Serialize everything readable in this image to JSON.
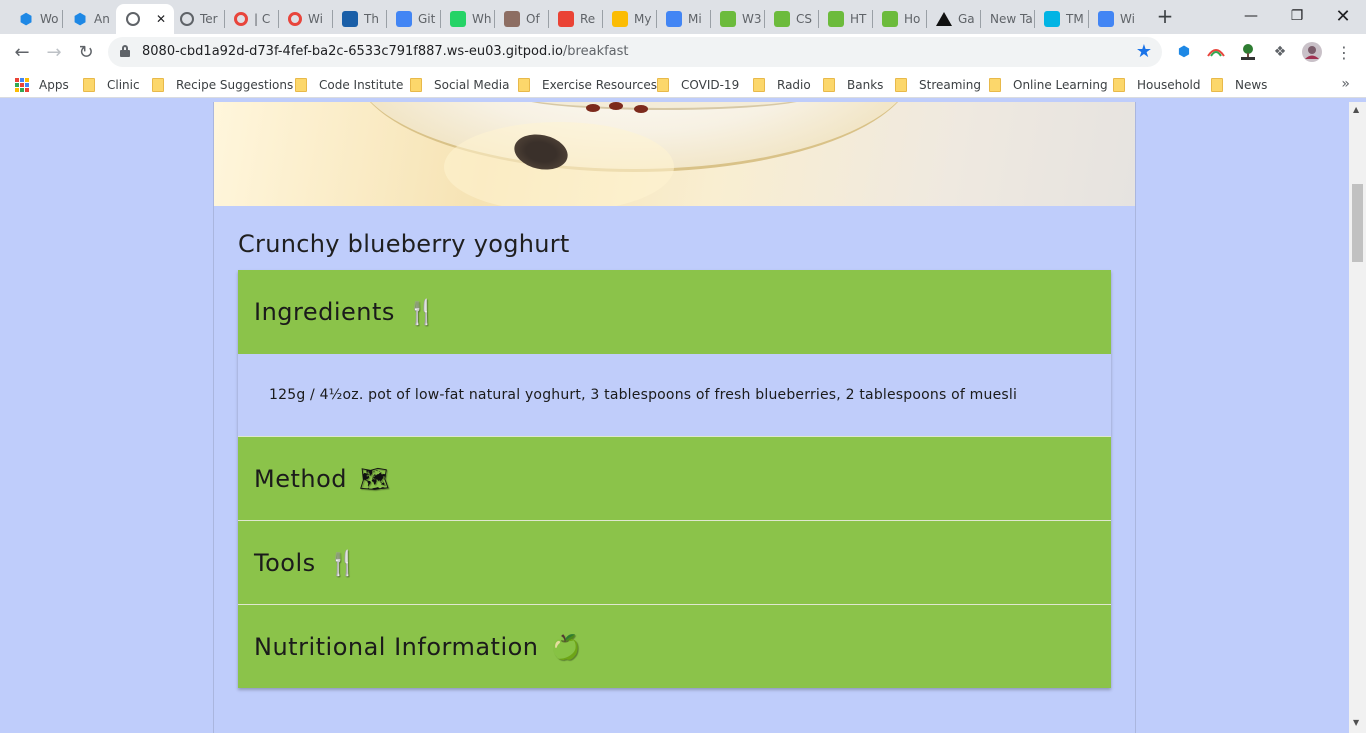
{
  "browser": {
    "tabs": [
      {
        "title": "Wo",
        "favicon": "gitpod-icon",
        "color": "#1e88e5"
      },
      {
        "title": "An",
        "favicon": "gitpod-icon",
        "color": "#1e88e5"
      },
      {
        "title": "",
        "favicon": "globe-icon",
        "color": "#5f6368",
        "active": true
      },
      {
        "title": "Ter",
        "favicon": "globe-icon",
        "color": "#5f6368"
      },
      {
        "title": "| C",
        "favicon": "opera-icon",
        "color": "#e8453c"
      },
      {
        "title": "Wi",
        "favicon": "opera-icon",
        "color": "#e8453c"
      },
      {
        "title": "Th",
        "favicon": "w3-icon",
        "color": "#1a5fa8"
      },
      {
        "title": "Git",
        "favicon": "docs-icon",
        "color": "#4285f4"
      },
      {
        "title": "Wh",
        "favicon": "whatsapp-icon",
        "color": "#25d366"
      },
      {
        "title": "Of",
        "favicon": "crest-icon",
        "color": "#8d6e63"
      },
      {
        "title": "Re",
        "favicon": "gmail-icon",
        "color": "#ea4335"
      },
      {
        "title": "My",
        "favicon": "drive-icon",
        "color": "#fbbc04"
      },
      {
        "title": "Mi",
        "favicon": "docs-icon",
        "color": "#4285f4"
      },
      {
        "title": "W3",
        "favicon": "w3c-icon",
        "color": "#6cbb3c"
      },
      {
        "title": "CS",
        "favicon": "w3c-icon",
        "color": "#6cbb3c"
      },
      {
        "title": "HT",
        "favicon": "w3c-icon",
        "color": "#6cbb3c"
      },
      {
        "title": "Ho",
        "favicon": "w3c-icon",
        "color": "#6cbb3c"
      },
      {
        "title": "Ga",
        "favicon": "triangle-icon",
        "color": "#111111"
      },
      {
        "title": "New Ta",
        "favicon": "",
        "color": ""
      },
      {
        "title": "TM",
        "favicon": "tmdb-icon",
        "color": "#01b4e4"
      },
      {
        "title": "Wi",
        "favicon": "google-icon",
        "color": "#4285f4"
      }
    ],
    "url_host": "8080-cbd1a92d-d73f-4fef-ba2c-6533c791f887.ws-eu03.gitpod.io",
    "url_path": "/breakfast",
    "bookmarks": [
      "Apps",
      "Clinic",
      "Recipe Suggestions",
      "Code Institute",
      "Social Media",
      "Exercise Resources",
      "COVID-19",
      "Radio",
      "Banks",
      "Streaming",
      "Online Learning",
      "Household",
      "News"
    ],
    "bookmarks_more": "»"
  },
  "page": {
    "recipe_title": "Crunchy blueberry yoghurt",
    "sections": [
      {
        "label": "Ingredients",
        "icon": "utensils-icon",
        "glyph": "🍴",
        "expanded": true,
        "body": "125g / 4½oz. pot of low-fat natural yoghurt, 3 tablespoons of fresh blueberries, 2 tablespoons of muesli"
      },
      {
        "label": "Method",
        "icon": "map-icon",
        "glyph": "🗺",
        "expanded": false
      },
      {
        "label": "Tools",
        "icon": "utensils-icon",
        "glyph": "🍴",
        "expanded": false
      },
      {
        "label": "Nutritional Information",
        "icon": "apple-icon",
        "glyph": "🍏",
        "expanded": false
      }
    ],
    "colors": {
      "background": "#bfcdfb",
      "accordion_header": "#8bc34a",
      "accordion_body": "#c0cdfa"
    }
  }
}
